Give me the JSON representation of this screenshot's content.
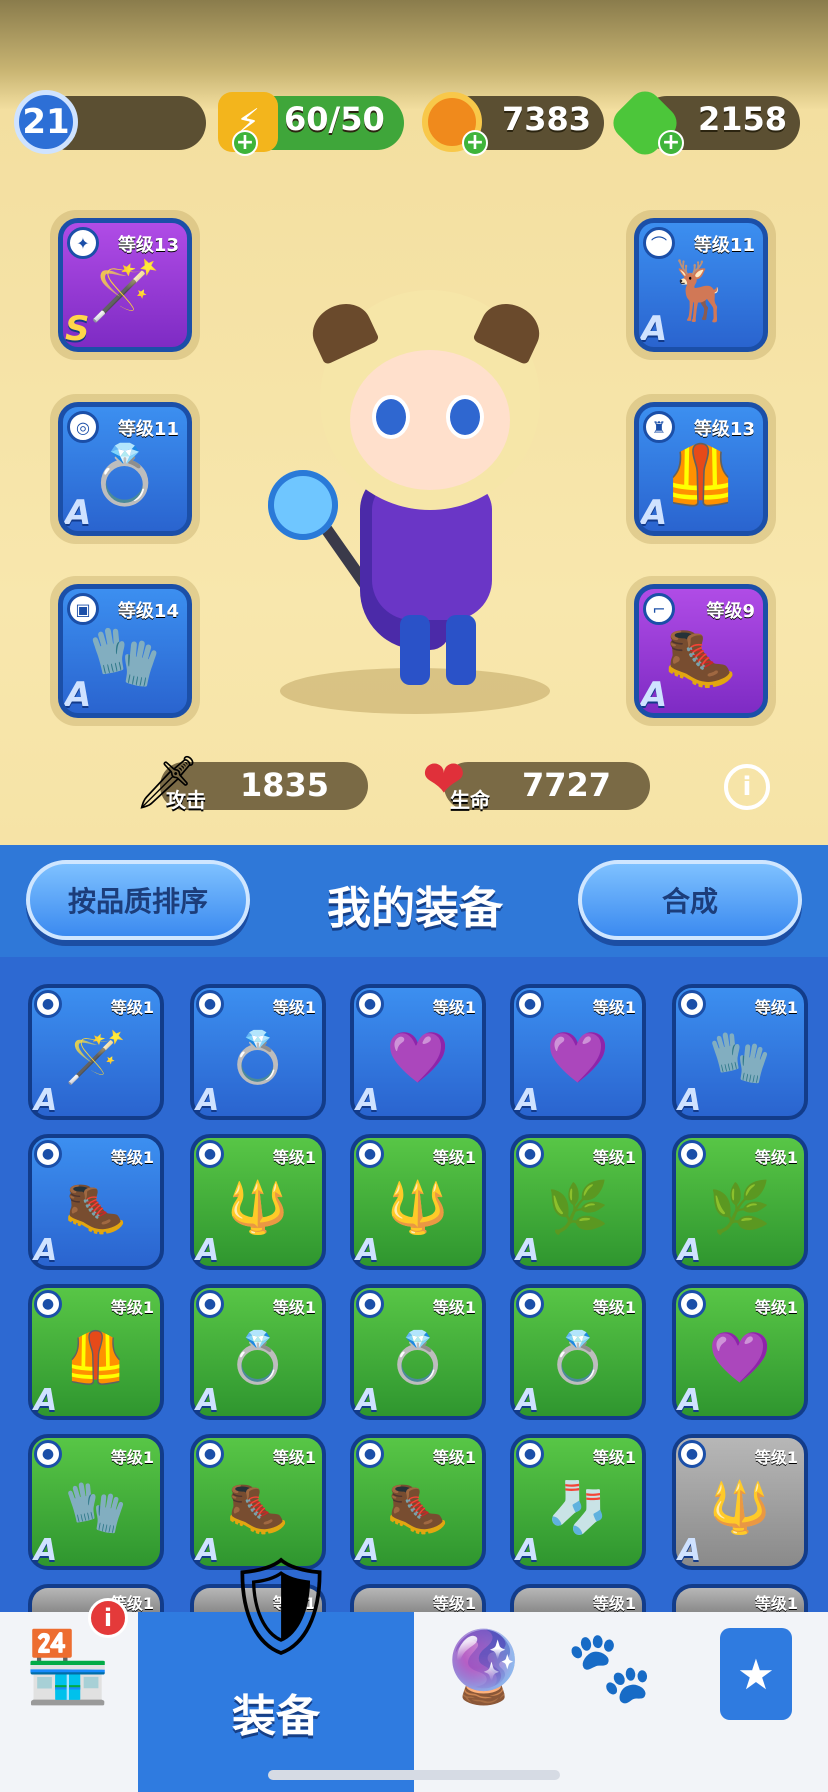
{
  "resources": {
    "player_level": "21",
    "energy": "60/50",
    "coins": "7383",
    "gems": "2158"
  },
  "equipped": {
    "left": [
      {
        "level": "等级13",
        "grade": "S",
        "color": "purple",
        "icon": "staff-icon"
      },
      {
        "level": "等级11",
        "grade": "A",
        "color": "blue",
        "icon": "ring-icon"
      },
      {
        "level": "等级14",
        "grade": "A",
        "color": "blue",
        "icon": "bracer-icon"
      }
    ],
    "right": [
      {
        "level": "等级11",
        "grade": "A",
        "color": "blue",
        "icon": "horns-icon"
      },
      {
        "level": "等级13",
        "grade": "A",
        "color": "blue",
        "icon": "armor-icon"
      },
      {
        "level": "等级9",
        "grade": "A",
        "color": "purple",
        "icon": "boots-icon"
      }
    ]
  },
  "stats": {
    "attack_label": "攻击",
    "attack_value": "1835",
    "hp_label": "生命",
    "hp_value": "7727"
  },
  "header": {
    "sort_button": "按品质排序",
    "title": "我的装备",
    "merge_button": "合成"
  },
  "inventory": [
    {
      "level": "等级1",
      "color": "blue",
      "art": "🪄"
    },
    {
      "level": "等级1",
      "color": "blue",
      "art": "💍"
    },
    {
      "level": "等级1",
      "color": "blue",
      "art": "💜"
    },
    {
      "level": "等级1",
      "color": "blue",
      "art": "💜"
    },
    {
      "level": "等级1",
      "color": "blue",
      "art": "🧤"
    },
    {
      "level": "等级1",
      "color": "blue",
      "art": "🥾"
    },
    {
      "level": "等级1",
      "color": "green",
      "art": "🔱"
    },
    {
      "level": "等级1",
      "color": "green",
      "art": "🔱"
    },
    {
      "level": "等级1",
      "color": "green",
      "art": "🌿"
    },
    {
      "level": "等级1",
      "color": "green",
      "art": "🌿"
    },
    {
      "level": "等级1",
      "color": "green",
      "art": "🦺"
    },
    {
      "level": "等级1",
      "color": "green",
      "art": "💍"
    },
    {
      "level": "等级1",
      "color": "green",
      "art": "💍"
    },
    {
      "level": "等级1",
      "color": "green",
      "art": "💍"
    },
    {
      "level": "等级1",
      "color": "green",
      "art": "💜"
    },
    {
      "level": "等级1",
      "color": "green",
      "art": "🧤"
    },
    {
      "level": "等级1",
      "color": "green",
      "art": "🥾"
    },
    {
      "level": "等级1",
      "color": "green",
      "art": "🥾"
    },
    {
      "level": "等级1",
      "color": "green",
      "art": "🧦"
    },
    {
      "level": "等级1",
      "color": "gray",
      "art": "🔱"
    }
  ],
  "inventory_partial_row": [
    "等级1",
    "等级1",
    "等级1",
    "等级1",
    "等级1"
  ],
  "nav": {
    "active_label": "装备",
    "badge": "i"
  }
}
